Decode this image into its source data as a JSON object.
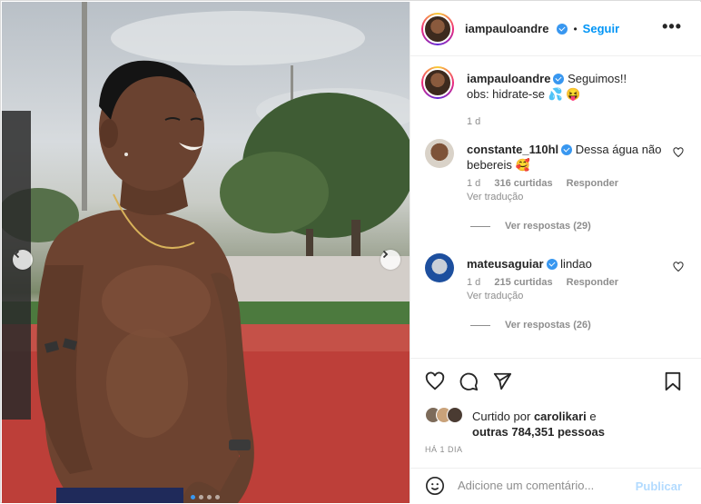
{
  "post": {
    "username": "iampauloandre",
    "follow_sep": "•",
    "follow_label": "Seguir",
    "more_label": "•••"
  },
  "caption": {
    "username": "iampauloandre",
    "text_line1": "Seguimos!!",
    "text_line2": "obs: hidrate-se",
    "emoji": "💦 😝",
    "time": "1 d"
  },
  "comments": [
    {
      "username": "constante_110hl",
      "text": "Dessa água não bebereis 🥰",
      "time": "1 d",
      "likes": "316 curtidas",
      "reply_label": "Responder",
      "translate_label": "Ver tradução",
      "view_replies": "Ver respostas (29)"
    },
    {
      "username": "mateusaguiar",
      "text": "lindao",
      "time": "1 d",
      "likes": "215 curtidas",
      "reply_label": "Responder",
      "translate_label": "Ver tradução",
      "view_replies": "Ver respostas (26)"
    }
  ],
  "likes": {
    "prefix": "Curtido por",
    "user": "carolikari",
    "suffix": "e",
    "others": "outras 784,351 pessoas"
  },
  "timestamp": "HÁ 1 DIA",
  "add_comment": {
    "placeholder": "Adicione um comentário...",
    "publish_label": "Publicar"
  },
  "carousel": {
    "slide_count": 4,
    "active_index": 0
  },
  "colors": {
    "accent": "#0095f6",
    "verified": "#3897f0",
    "muted": "#8e8e8e",
    "publish_disabled": "#b3dbff"
  },
  "icons": [
    "chevron-left-icon",
    "chevron-right-icon",
    "more-icon",
    "verified-icon",
    "heart-icon",
    "comment-icon",
    "share-icon",
    "bookmark-icon",
    "emoji-icon"
  ]
}
